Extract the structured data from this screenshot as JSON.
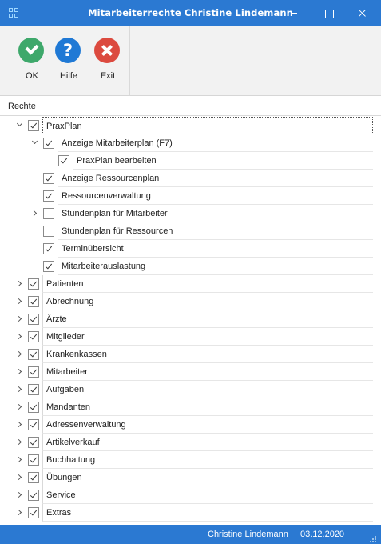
{
  "window": {
    "title": "Mitarbeiterrechte Christine Lindemann",
    "accent": "#2b79d2"
  },
  "toolbar": {
    "ok_label": "OK",
    "help_label": "Hilfe",
    "exit_label": "Exit",
    "help_glyph": "?",
    "colors": {
      "ok": "#3ea86b",
      "help": "#1f79d5",
      "exit": "#dc4a3f"
    }
  },
  "tree": {
    "header": "Rechte",
    "items": [
      {
        "label": "PraxPlan",
        "checked": true,
        "expander": "expanded",
        "level": 0,
        "selected": true
      },
      {
        "label": "Anzeige Mitarbeiterplan (F7)",
        "checked": true,
        "expander": "expanded",
        "level": 1
      },
      {
        "label": "PraxPlan bearbeiten",
        "checked": true,
        "expander": "none",
        "level": 2
      },
      {
        "label": "Anzeige Ressourcenplan",
        "checked": true,
        "expander": "none",
        "level": 1
      },
      {
        "label": "Ressourcenverwaltung",
        "checked": true,
        "expander": "none",
        "level": 1
      },
      {
        "label": "Stundenplan für Mitarbeiter",
        "checked": false,
        "expander": "collapsed",
        "level": 1
      },
      {
        "label": "Stundenplan für Ressourcen",
        "checked": false,
        "expander": "none",
        "level": 1
      },
      {
        "label": "Terminübersicht",
        "checked": true,
        "expander": "none",
        "level": 1
      },
      {
        "label": "Mitarbeiterauslastung",
        "checked": true,
        "expander": "none",
        "level": 1
      },
      {
        "label": "Patienten",
        "checked": true,
        "expander": "collapsed",
        "level": 0
      },
      {
        "label": "Abrechnung",
        "checked": true,
        "expander": "collapsed",
        "level": 0
      },
      {
        "label": "Ärzte",
        "checked": true,
        "expander": "collapsed",
        "level": 0
      },
      {
        "label": "Mitglieder",
        "checked": true,
        "expander": "collapsed",
        "level": 0
      },
      {
        "label": "Krankenkassen",
        "checked": true,
        "expander": "collapsed",
        "level": 0
      },
      {
        "label": "Mitarbeiter",
        "checked": true,
        "expander": "collapsed",
        "level": 0
      },
      {
        "label": "Aufgaben",
        "checked": true,
        "expander": "collapsed",
        "level": 0
      },
      {
        "label": "Mandanten",
        "checked": true,
        "expander": "collapsed",
        "level": 0
      },
      {
        "label": "Adressenverwaltung",
        "checked": true,
        "expander": "collapsed",
        "level": 0
      },
      {
        "label": "Artikelverkauf",
        "checked": true,
        "expander": "collapsed",
        "level": 0
      },
      {
        "label": "Buchhaltung",
        "checked": true,
        "expander": "collapsed",
        "level": 0
      },
      {
        "label": "Übungen",
        "checked": true,
        "expander": "collapsed",
        "level": 0
      },
      {
        "label": "Service",
        "checked": true,
        "expander": "collapsed",
        "level": 0
      },
      {
        "label": "Extras",
        "checked": true,
        "expander": "collapsed",
        "level": 0
      }
    ]
  },
  "statusbar": {
    "user": "Christine Lindemann",
    "date": "03.12.2020"
  }
}
